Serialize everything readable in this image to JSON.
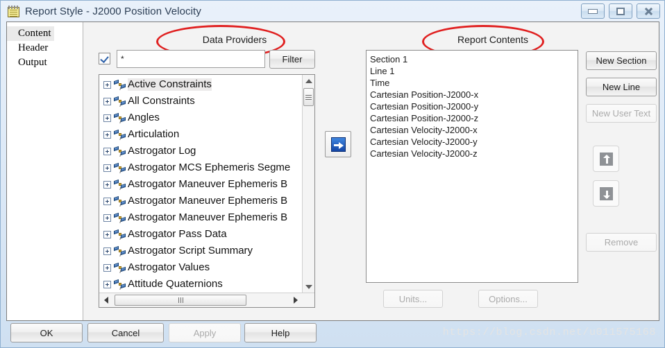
{
  "window": {
    "title": "Report Style - J2000 Position Velocity",
    "icon": "notepad-icon",
    "controls": {
      "minimize": "minimize-icon",
      "maximize": "maximize-icon",
      "close": "close-icon"
    }
  },
  "sidebar": {
    "items": [
      {
        "label": "Content",
        "selected": true
      },
      {
        "label": "Header",
        "selected": false
      },
      {
        "label": "Output",
        "selected": false
      }
    ]
  },
  "data_providers": {
    "caption": "Data Providers",
    "annotation_color": "#e02020",
    "filter_enabled_checkbox": true,
    "filter_value": "*",
    "filter_placeholder": "",
    "filter_button": "Filter",
    "items": [
      "Active Constraints",
      "All Constraints",
      "Angles",
      "Articulation",
      "Astrogator Log",
      "Astrogator MCS Ephemeris Segme",
      "Astrogator Maneuver Ephemeris B",
      "Astrogator Maneuver Ephemeris B",
      "Astrogator Maneuver Ephemeris B",
      "Astrogator Pass Data",
      "Astrogator Script Summary",
      "Astrogator Values",
      "Attitude Quaternions"
    ],
    "selected_index": 0,
    "item_icon": "satellite-icon",
    "expander_icon": "plus-expander-icon"
  },
  "transfer": {
    "button_icon": "arrow-right-icon",
    "tooltip": ""
  },
  "report_contents": {
    "caption": "Report Contents",
    "annotation_color": "#e02020",
    "items": [
      "Section 1",
      "Line 1",
      "Time",
      "Cartesian Position-J2000-x",
      "Cartesian Position-J2000-y",
      "Cartesian Position-J2000-z",
      "Cartesian Velocity-J2000-x",
      "Cartesian Velocity-J2000-y",
      "Cartesian Velocity-J2000-z"
    ]
  },
  "side_actions": {
    "new_section": {
      "label": "New Section",
      "disabled": false
    },
    "new_line": {
      "label": "New Line",
      "disabled": false
    },
    "new_user_text": {
      "label": "New User Text",
      "disabled": true
    },
    "move_up": {
      "icon": "arrow-up-icon",
      "disabled": true
    },
    "move_down": {
      "icon": "arrow-down-icon",
      "disabled": true
    },
    "remove": {
      "label": "Remove",
      "disabled": true
    }
  },
  "lower_actions": {
    "units": {
      "label": "Units...",
      "disabled": true
    },
    "options": {
      "label": "Options...",
      "disabled": true
    }
  },
  "dialog_buttons": {
    "ok": {
      "label": "OK",
      "disabled": false
    },
    "cancel": {
      "label": "Cancel",
      "disabled": false
    },
    "apply": {
      "label": "Apply",
      "disabled": true
    },
    "help": {
      "label": "Help",
      "disabled": false
    }
  },
  "watermark": "https://blog.csdn.net/u011575168"
}
